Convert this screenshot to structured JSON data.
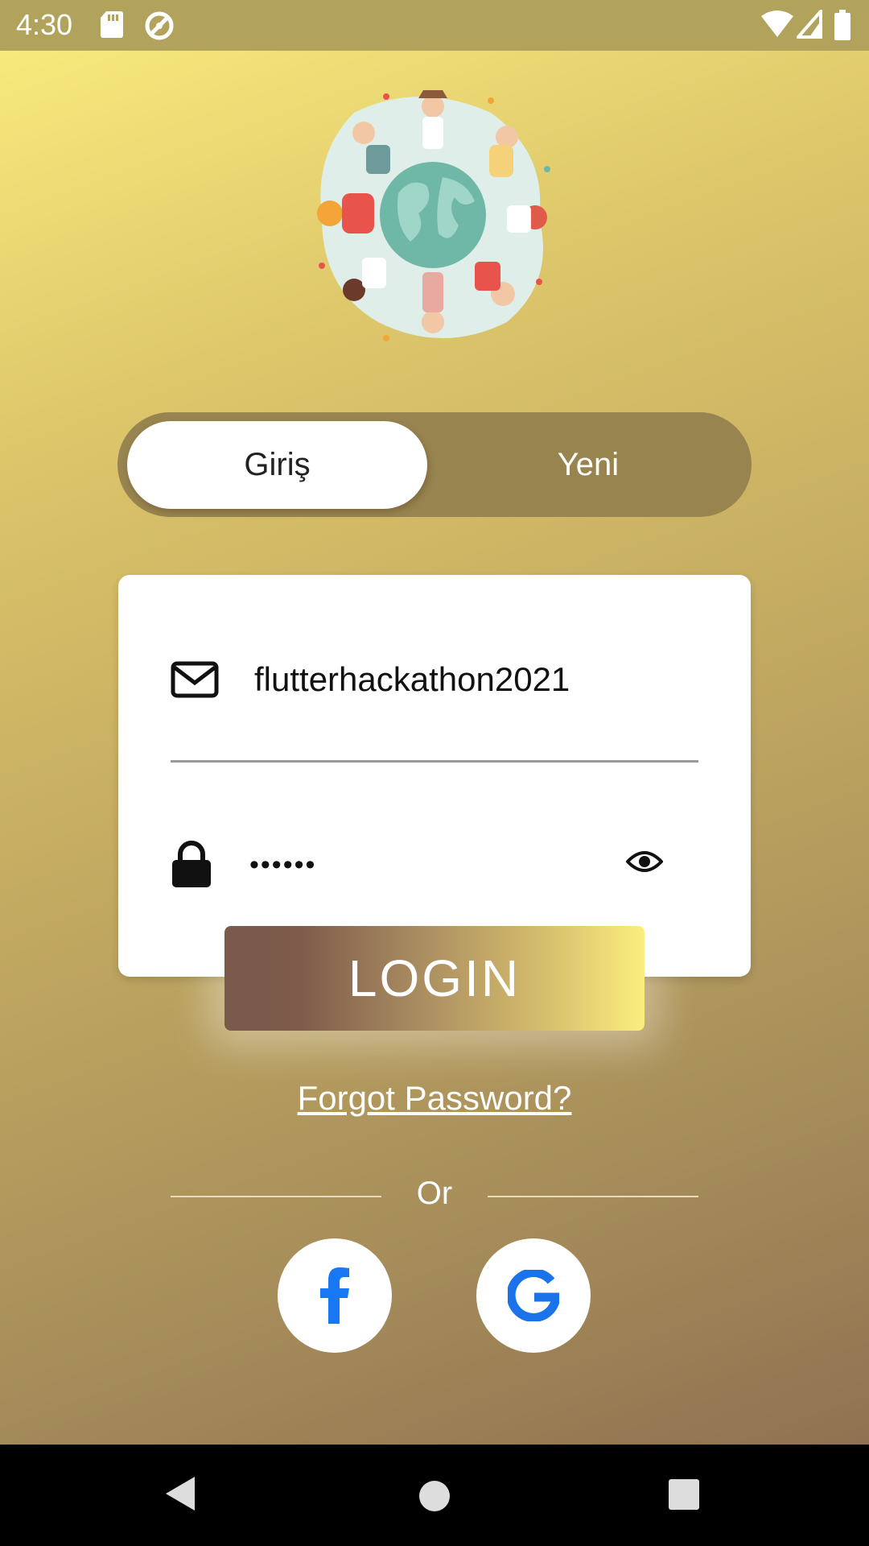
{
  "status_bar": {
    "time": "4:30",
    "icons": [
      "sd-card-icon",
      "sync-icon",
      "wifi-icon",
      "signal-icon",
      "battery-icon"
    ]
  },
  "logo": {
    "icon": "globe-people-illustration"
  },
  "tabs": {
    "active_label": "Giriş",
    "inactive_label": "Yeni"
  },
  "form": {
    "email_value": "flutterhackathon2021",
    "password_value": "••••••",
    "email_icon": "envelope-icon",
    "password_icon": "lock-icon",
    "toggle_visibility_icon": "eye-icon"
  },
  "actions": {
    "login_label": "LOGIN",
    "forgot_label": "Forgot Password?",
    "divider_label": "Or"
  },
  "social": {
    "facebook_icon": "facebook-icon",
    "google_icon": "google-icon"
  },
  "colors": {
    "gradient_top": "#fbee7e",
    "gradient_bottom": "#8a6a4f",
    "toggle_bg": "#97844f",
    "facebook_blue": "#1877f2",
    "google_blue": "#1a73e8"
  }
}
